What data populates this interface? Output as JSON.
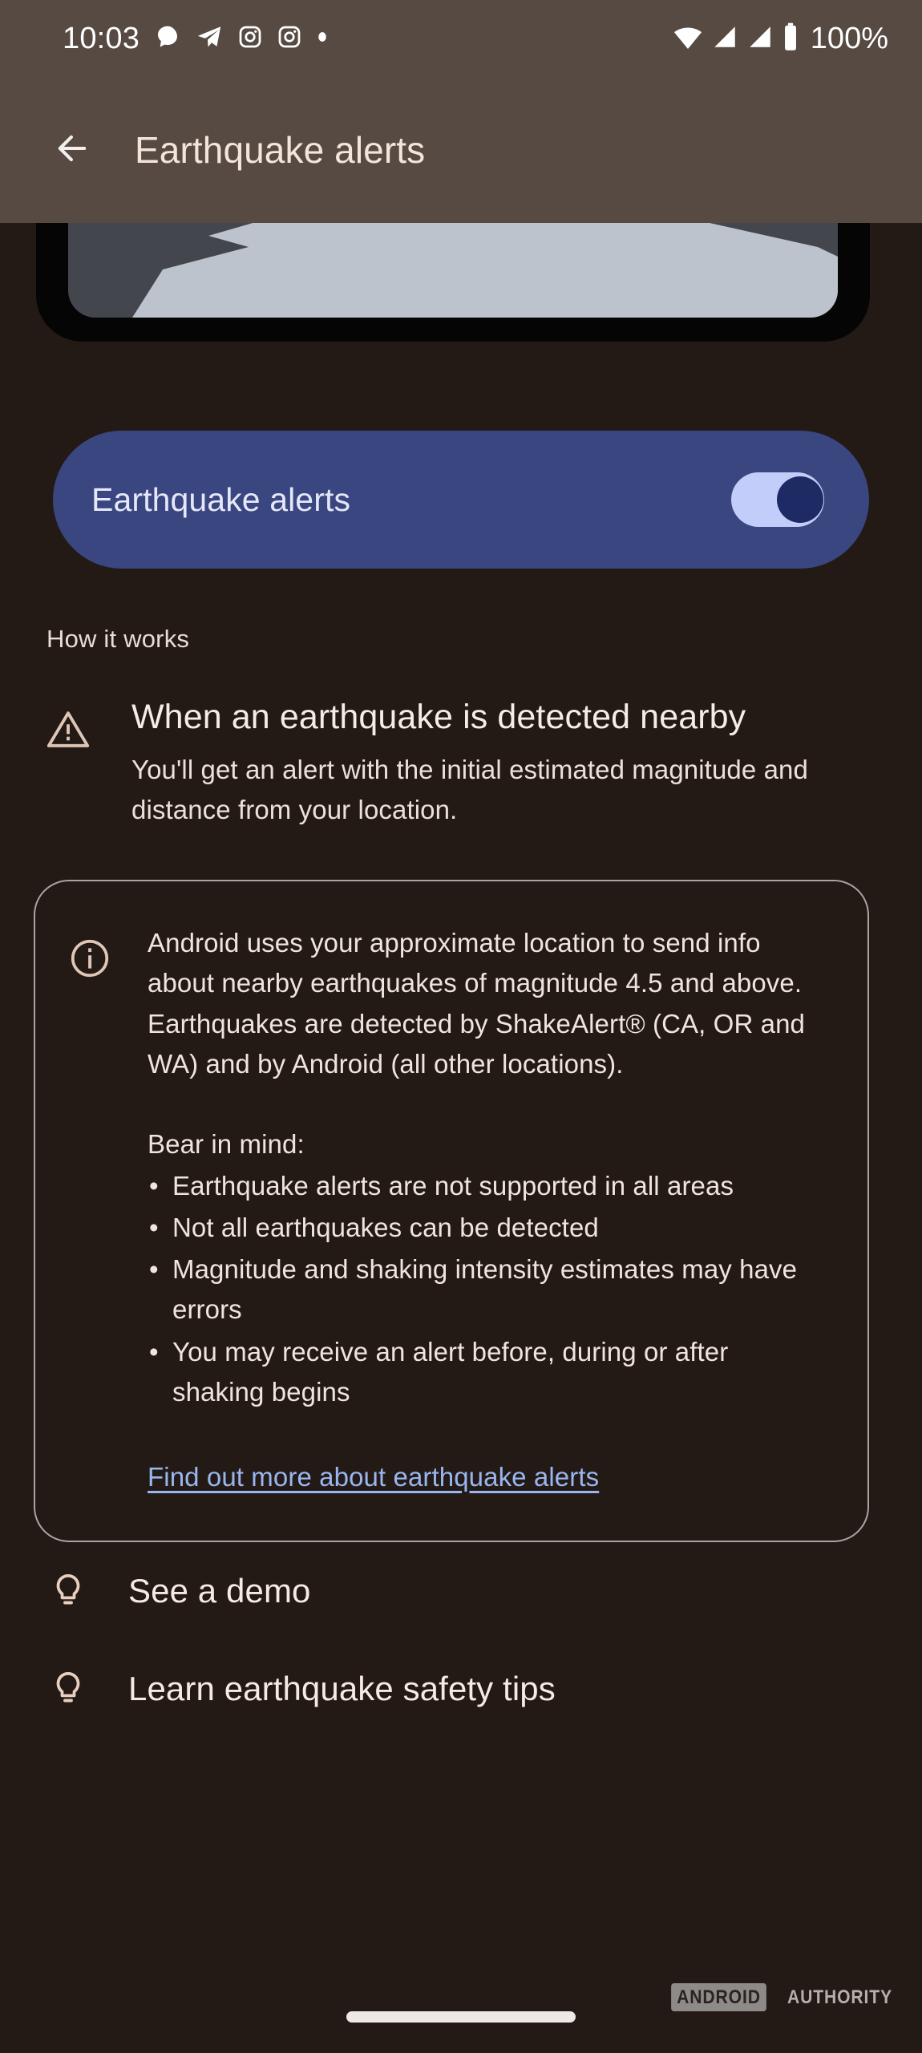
{
  "status_bar": {
    "time": "10:03",
    "battery_percent": "100%",
    "left_icons": [
      "chat-bubble-icon",
      "telegram-send-icon",
      "instagram-icon",
      "instagram-icon",
      "notification-dot-icon"
    ],
    "right_icons": [
      "wifi-icon",
      "signal-bars-icon",
      "signal-bars-icon",
      "battery-full-icon"
    ]
  },
  "app_bar": {
    "back_icon": "back-arrow-icon",
    "title": "Earthquake alerts"
  },
  "hero": {
    "illustration": "phone-with-earthquake-crack-illustration",
    "screen_color": "#43464d",
    "crack_color": "#bcc3cc",
    "bezel_color": "#050505"
  },
  "toggle_card": {
    "label": "Earthquake alerts",
    "state": "on",
    "card_color": "#3a4680",
    "track_color": "#c3cdf9",
    "thumb_color": "#1d2a63"
  },
  "section": {
    "header": "How it works"
  },
  "how_it_works": {
    "icon": "warning-triangle-icon",
    "title": "When an earthquake is detected nearby",
    "body": "You'll get an alert with the initial estimated magnitude and distance from your location."
  },
  "info_card": {
    "icon": "info-circle-icon",
    "paragraph": "Android uses your approximate location to send info about nearby earthquakes of magnitude 4.5 and above. Earthquakes are detected by ShakeAlert® (CA, OR and WA) and by Android (all other locations).",
    "bear_in_mind_label": "Bear in mind:",
    "bullets": [
      "Earthquake alerts are not supported in all areas",
      "Not all earthquakes can be detected",
      "Magnitude and shaking intensity estimates may have errors",
      "You may receive an alert before, during or after shaking begins"
    ],
    "link": "Find out more about earthquake alerts",
    "link_color": "#9ab6f0"
  },
  "actions": [
    {
      "icon": "lightbulb-icon",
      "label": "See a demo"
    },
    {
      "icon": "lightbulb-icon",
      "label": "Learn earthquake safety tips"
    }
  ],
  "watermark": {
    "box_text": "ANDROID",
    "text": "AUTHORITY"
  }
}
